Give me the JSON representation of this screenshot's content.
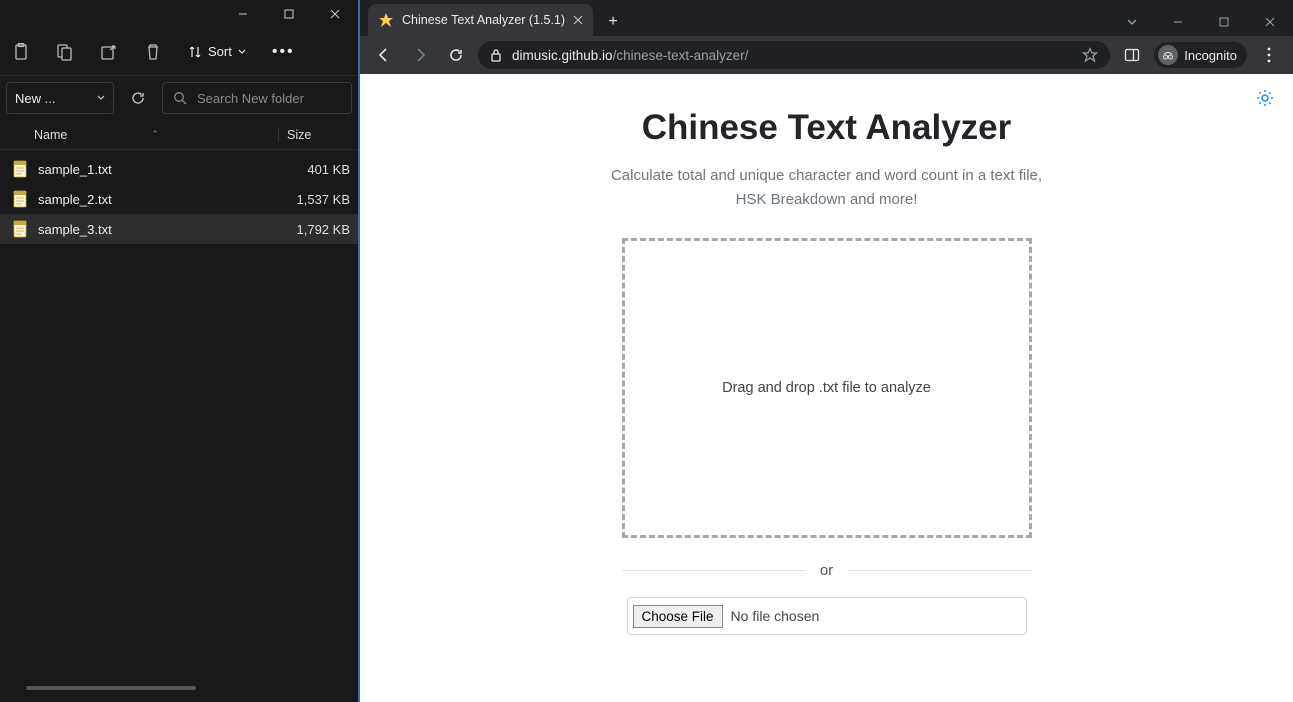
{
  "explorer": {
    "sort_label": "Sort",
    "breadcrumb": "New ...",
    "search_placeholder": "Search New folder",
    "columns": {
      "name": "Name",
      "size": "Size"
    },
    "files": [
      {
        "name": "sample_1.txt",
        "size": "401 KB",
        "selected": false
      },
      {
        "name": "sample_2.txt",
        "size": "1,537 KB",
        "selected": false
      },
      {
        "name": "sample_3.txt",
        "size": "1,792 KB",
        "selected": true
      }
    ]
  },
  "browser": {
    "tab_title": "Chinese Text Analyzer (1.5.1)",
    "url_host": "dimusic.github.io",
    "url_path": "/chinese-text-analyzer/",
    "incognito_label": "Incognito"
  },
  "page": {
    "title": "Chinese Text Analyzer",
    "subtitle_line1": "Calculate total and unique character and word count in a text file,",
    "subtitle_line2": "HSK Breakdown and more!",
    "dropzone_text": "Drag and drop .txt file to analyze",
    "or_label": "or",
    "choose_file_label": "Choose File",
    "no_file_label": "No file chosen"
  }
}
